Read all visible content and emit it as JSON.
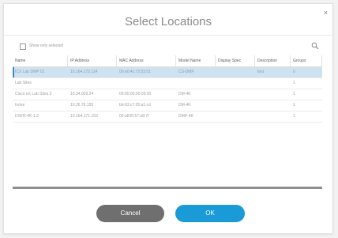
{
  "dialog": {
    "title": "Select Locations",
    "close_glyph": "×"
  },
  "toolbar": {
    "show_only_selected_label": "Show only selected",
    "search_icon": "search-icon"
  },
  "table": {
    "columns": [
      "Name",
      "IP Address",
      "MAC Address",
      "Model Name",
      "Display Spec",
      "Description",
      "Groups"
    ],
    "rows": [
      {
        "selected": true,
        "cells": [
          "ICX Lab DMP 01",
          "10.164.172.114",
          "00:e0:4c:72:53:01",
          "CS-DMP",
          "",
          "test",
          "0"
        ]
      },
      {
        "selected": false,
        "cells": [
          "Lab Sites",
          "",
          "",
          "",
          "",
          "",
          "1"
        ]
      },
      {
        "selected": false,
        "cells": [
          "Cisco eX Lab Sites 2",
          "10.34.009.24",
          "00:00:00:00:00:00",
          "DM-4K",
          "",
          "",
          "1"
        ]
      },
      {
        "selected": false,
        "cells": [
          "Irvine",
          "10.26.76.155",
          "bb:63:c7:05:a1:cd",
          "DM-4K",
          "",
          "",
          "1"
        ]
      },
      {
        "selected": false,
        "cells": [
          "DSFR-4K-1.2",
          "10.164.171.153",
          "00:a8:f0:57:a8:7f",
          "DMP-4K",
          "",
          "",
          "1"
        ]
      }
    ]
  },
  "buttons": {
    "cancel_label": "Cancel",
    "ok_label": "OK"
  },
  "colors": {
    "selected_row": "#cfe2f1",
    "ok_button": "#1a9ad6",
    "cancel_button": "#6f6f6f"
  }
}
